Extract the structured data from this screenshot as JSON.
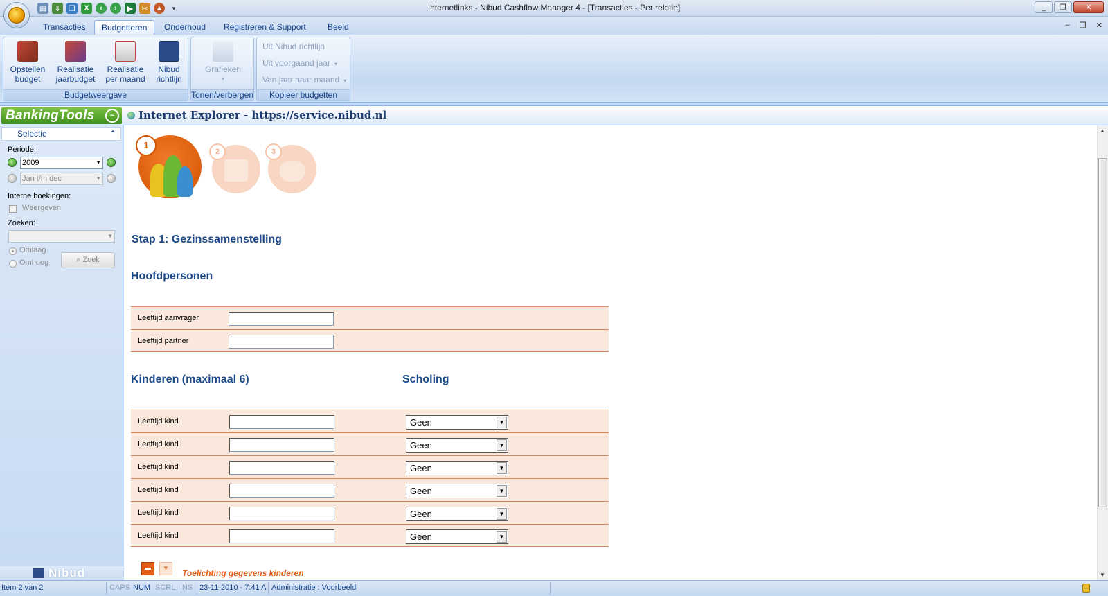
{
  "window": {
    "title": "Internetlinks - Nibud Cashflow Manager 4 - [Transacties - Per relatie]"
  },
  "ribbon_tabs": [
    "Transacties",
    "Budgetteren",
    "Onderhoud",
    "Registreren & Support",
    "Beeld"
  ],
  "active_tab": "Budgetteren",
  "ribbon": {
    "budgetweergave": {
      "label": "Budgetweergave",
      "buttons": [
        {
          "line1": "Opstellen",
          "line2": "budget"
        },
        {
          "line1": "Realisatie",
          "line2": "jaarbudget"
        },
        {
          "line1": "Realisatie",
          "line2": "per maand"
        },
        {
          "line1": "Nibud",
          "line2": "richtlijn"
        }
      ]
    },
    "tonen": {
      "label": "Tonen/verbergen",
      "grafieken": "Grafieken"
    },
    "kopieer": {
      "label": "Kopieer budgetten",
      "items": [
        "Uit Nibud richtlijn",
        "Uit voorgaand jaar",
        "Van jaar naar maand"
      ]
    }
  },
  "bankingtools": {
    "logo": "BankingTools",
    "url_title": "Internet Explorer - https://service.nibud.nl"
  },
  "selectie": {
    "header": "Selectie",
    "periode_label": "Periode:",
    "periode_value": "2009",
    "range_value": "Jan t/m dec",
    "interne_label": "Interne boekingen:",
    "weergeven": "Weergeven",
    "zoeken_label": "Zoeken:",
    "zoeken_value": "",
    "omlaag": "Omlaag",
    "omhoog": "Omhoog",
    "zoek_button": "Zoek",
    "footer_logo": "Nibud"
  },
  "form": {
    "steps": [
      "1",
      "2",
      "3"
    ],
    "step_title": "Stap 1: Gezinssamenstelling",
    "hoofdpersonen_title": "Hoofdpersonen",
    "hoofdpersonen": [
      {
        "label": "Leeftijd aanvrager",
        "value": ""
      },
      {
        "label": "Leeftijd partner",
        "value": ""
      }
    ],
    "kinderen_title": "Kinderen (maximaal 6)",
    "scholing_title": "Scholing",
    "kinderen": [
      {
        "label": "Leeftijd kind",
        "value": "",
        "scholing": "Geen"
      },
      {
        "label": "Leeftijd kind",
        "value": "",
        "scholing": "Geen"
      },
      {
        "label": "Leeftijd kind",
        "value": "",
        "scholing": "Geen"
      },
      {
        "label": "Leeftijd kind",
        "value": "",
        "scholing": "Geen"
      },
      {
        "label": "Leeftijd kind",
        "value": "",
        "scholing": "Geen"
      },
      {
        "label": "Leeftijd kind",
        "value": "",
        "scholing": "Geen"
      }
    ],
    "toelichting": "Toelichting gegevens kinderen"
  },
  "statusbar": {
    "item": "Item 2 van 2",
    "caps": "CAPS",
    "num": "NUM",
    "scrl": "SCRL",
    "ins": "INS",
    "datetime": "23-11-2010 - 7:41 A",
    "administratie": "Administratie : Voorbeeld"
  },
  "colors": {
    "accent_orange": "#e45d17",
    "form_row_bg": "#fbe8dc",
    "heading_blue": "#1e4a8a",
    "ribbon_text": "#15428b"
  }
}
